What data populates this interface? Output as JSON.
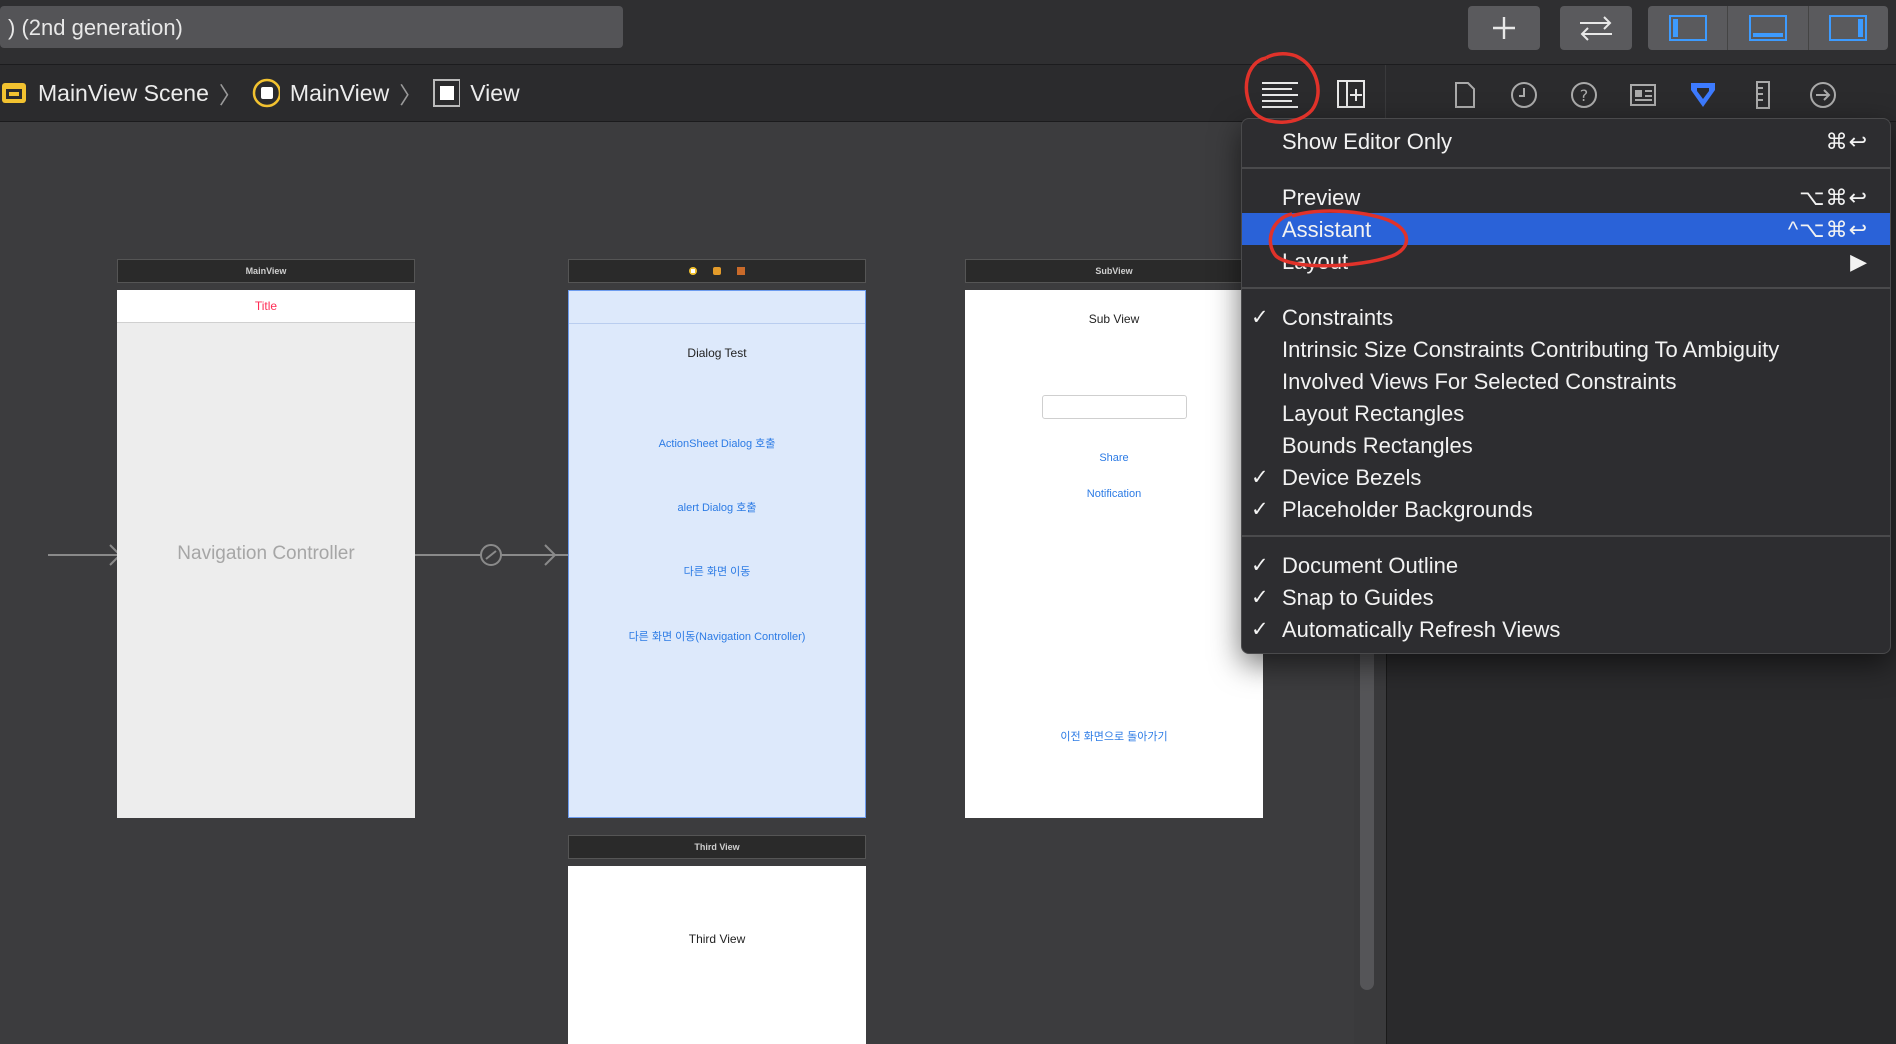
{
  "toolbar": {
    "scheme_text": ") (2nd generation)",
    "add_icon": "plus-icon",
    "swap_icon": "arrows-left-right-icon",
    "layout_icons": [
      "navigator-panel-icon",
      "debug-area-icon",
      "inspector-panel-icon"
    ]
  },
  "jumpbar": {
    "crumbs": [
      {
        "label": "MainView Scene",
        "icon": "scene-icon"
      },
      {
        "label": "MainView",
        "icon": "view-controller-icon"
      },
      {
        "label": "View",
        "icon": "view-icon"
      }
    ],
    "editor_options_icon": "editor-options-icon",
    "add_editor_icon": "add-editor-icon"
  },
  "inspector": {
    "tabs": [
      "file-inspector-icon",
      "history-icon",
      "quick-help-icon",
      "identity-inspector-icon",
      "attributes-inspector-icon",
      "size-inspector-icon",
      "connections-inspector-icon"
    ]
  },
  "canvas": {
    "main_scene": {
      "title": "MainView",
      "nav_title": "Title",
      "label": "Navigation Controller"
    },
    "dialog_scene": {
      "heading": "Dialog Test",
      "buttons": [
        "ActionSheet Dialog 호출",
        "alert Dialog 호출",
        "다른 화면 이동",
        "다른 화면 이동(Navigation Controller)"
      ]
    },
    "sub_scene": {
      "title": "SubView",
      "heading": "Sub View",
      "buttons": [
        "Share",
        "Notification"
      ],
      "back_button": "이전 화면으로 돌아가기"
    },
    "third_scene": {
      "title": "Third View",
      "heading": "Third View"
    }
  },
  "menu": {
    "show_editor_only": {
      "label": "Show Editor Only",
      "shortcut": "⌘↩"
    },
    "preview": {
      "label": "Preview",
      "shortcut": "⌥⌘↩"
    },
    "assistant": {
      "label": "Assistant",
      "shortcut": "^⌥⌘↩"
    },
    "layout": {
      "label": "Layout",
      "submenu": "▶"
    },
    "options": [
      {
        "label": "Constraints",
        "checked": true
      },
      {
        "label": "Intrinsic Size Constraints Contributing To Ambiguity",
        "checked": false
      },
      {
        "label": "Involved Views For Selected Constraints",
        "checked": false
      },
      {
        "label": "Layout Rectangles",
        "checked": false
      },
      {
        "label": "Bounds Rectangles",
        "checked": false
      },
      {
        "label": "Device Bezels",
        "checked": true
      },
      {
        "label": "Placeholder Backgrounds",
        "checked": true
      }
    ],
    "view_options": [
      {
        "label": "Document Outline",
        "checked": true
      },
      {
        "label": "Snap to Guides",
        "checked": true
      },
      {
        "label": "Automatically Refresh Views",
        "checked": true
      }
    ],
    "check_mark": "✓"
  },
  "colors": {
    "highlight": "#2a62d8",
    "annotation": "#e0322a",
    "accent": "#2c7be5",
    "nav_title": "#ff2d55"
  }
}
